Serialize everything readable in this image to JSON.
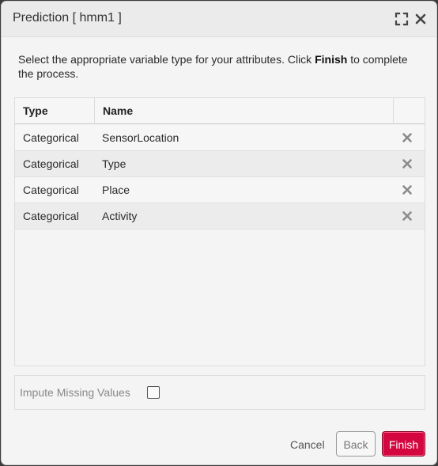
{
  "dialog": {
    "title": "Prediction [ hmm1 ]",
    "icons": {
      "expand": "expand-icon",
      "close": "close-icon"
    }
  },
  "instruction": {
    "before": "Select the appropriate variable type for your attributes. Click ",
    "emphasis": "Finish",
    "after": " to complete the process."
  },
  "table": {
    "columns": [
      "Type",
      "Name"
    ],
    "rows": [
      {
        "type": "Categorical",
        "name": "SensorLocation"
      },
      {
        "type": "Categorical",
        "name": "Type"
      },
      {
        "type": "Categorical",
        "name": "Place"
      },
      {
        "type": "Categorical",
        "name": "Activity"
      }
    ],
    "row_action_icon": "remove-icon"
  },
  "options": {
    "impute_label": "Impute Missing Values",
    "impute_checked": false
  },
  "buttons": {
    "cancel": "Cancel",
    "back": "Back",
    "finish": "Finish"
  },
  "colors": {
    "accent": "#d4063f",
    "dialog_bg": "#f4f4f4",
    "titlebar_bg": "#ebebeb"
  }
}
